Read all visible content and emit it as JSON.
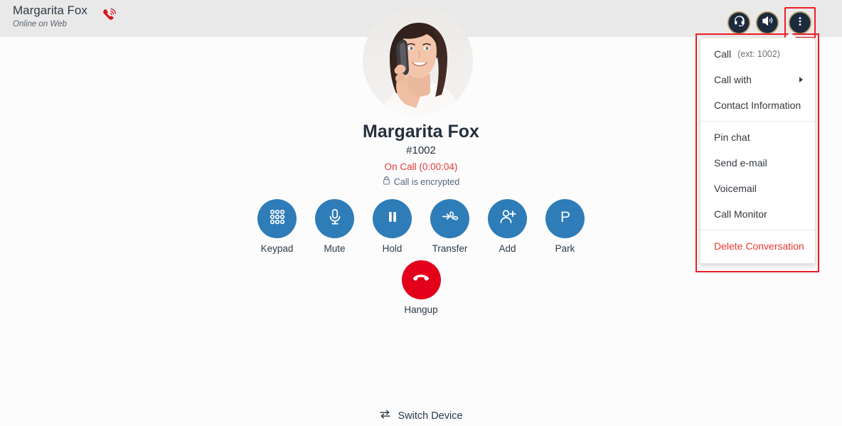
{
  "header": {
    "contact_name": "Margarita Fox",
    "presence": "Online on Web",
    "ring_icon": "ringing-phone-icon",
    "buttons": [
      {
        "name": "headset-icon",
        "label": "Headset"
      },
      {
        "name": "speaker-icon",
        "label": "Speaker"
      },
      {
        "name": "more-options-icon",
        "label": "More options"
      }
    ]
  },
  "call": {
    "avatar_alt": "Margarita Fox avatar",
    "name": "Margarita Fox",
    "extension": "#1002",
    "state": "On Call (0:00:04)",
    "encryption": "Call is encrypted",
    "lock_icon": "lock-icon"
  },
  "actions": [
    {
      "label": "Keypad",
      "icon": "keypad-icon"
    },
    {
      "label": "Mute",
      "icon": "microphone-icon"
    },
    {
      "label": "Hold",
      "icon": "pause-icon"
    },
    {
      "label": "Transfer",
      "icon": "transfer-call-icon"
    },
    {
      "label": "Add",
      "icon": "add-person-icon"
    },
    {
      "label": "Park",
      "icon": "park-icon"
    }
  ],
  "hangup": {
    "label": "Hangup",
    "icon": "hangup-phone-icon"
  },
  "switch_device": {
    "label": "Switch Device",
    "icon": "swap-arrows-icon"
  },
  "menu": {
    "items": [
      {
        "label": "Call",
        "extension": "(ext: 1002)",
        "submenu": false
      },
      {
        "label": "Call with",
        "submenu": true
      },
      {
        "label": "Contact Information",
        "submenu": false
      },
      {
        "label": "Pin chat",
        "submenu": false
      },
      {
        "label": "Send e-mail",
        "submenu": false
      },
      {
        "label": "Voicemail",
        "submenu": false
      },
      {
        "label": "Call Monitor",
        "submenu": false
      },
      {
        "label": "Delete Conversation",
        "submenu": false
      }
    ]
  },
  "colors": {
    "header_bg": "#e9e9e9",
    "body_bg": "#fcfcfc",
    "action_blue": "#2e7cb8",
    "hangup_red": "#e2001a",
    "highlight_red": "#ee1c25",
    "status_red": "#e03a3a",
    "icon_navy": "#1b2a3d"
  }
}
